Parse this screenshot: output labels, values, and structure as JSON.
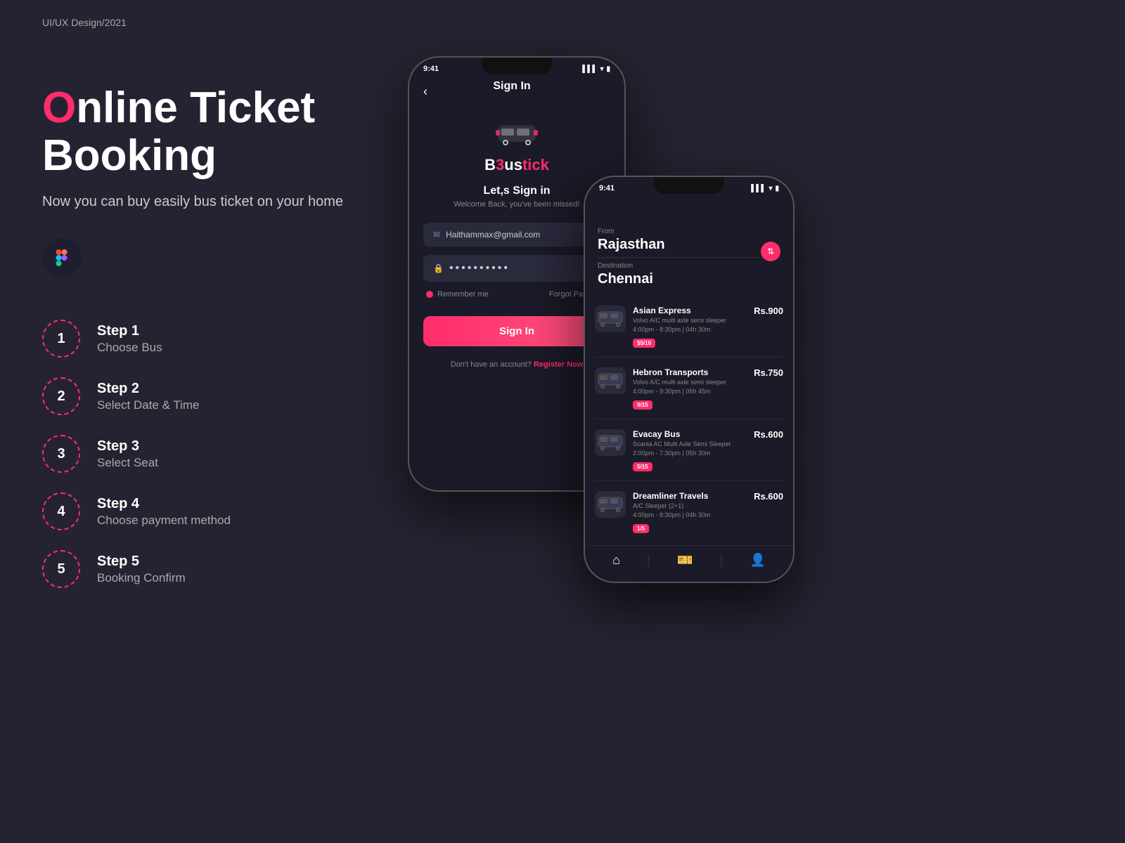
{
  "header": {
    "label": "UI/UX Design/2021"
  },
  "hero": {
    "title_prefix": "",
    "title_accent": "O",
    "title_rest": "nline Ticket Booking",
    "subtitle": "Now you can buy easily bus ticket on your home"
  },
  "steps": [
    {
      "number": "1",
      "title": "Step 1",
      "desc": "Choose Bus"
    },
    {
      "number": "2",
      "title": "Step 2",
      "desc": "Select Date & Time"
    },
    {
      "number": "3",
      "title": "Step 3",
      "desc": "Select Seat"
    },
    {
      "number": "4",
      "title": "Step 4",
      "desc": "Choose payment method"
    },
    {
      "number": "5",
      "title": "Step 5",
      "desc": "Booking Confirm"
    }
  ],
  "phone1": {
    "time": "9:41",
    "screen_title": "Sign In",
    "logo_prefix": "B",
    "logo_name": "ustick",
    "welcome_title": "Let,s Sign in",
    "welcome_sub": "Welcome Back, you've been missed!",
    "email_value": "Haithammax@gmail.com",
    "password_dots": "••••••••••",
    "remember_label": "Remember me",
    "forgot_label": "Forgot Password",
    "signin_btn": "Sign In",
    "register_text": "Don't have an account?",
    "register_link": "Register Now"
  },
  "phone2": {
    "time": "9:41",
    "from_label": "From",
    "from_city": "Rajasthan",
    "dest_label": "Destination",
    "dest_city": "Chennai",
    "buses": [
      {
        "name": "Asian Express",
        "type": "Volvo A/C multi axle semi sleeper",
        "time": "4:00pm - 8:30pm | 04h 30m",
        "seats": "$5/10",
        "price": "Rs.900"
      },
      {
        "name": "Hebron Transports",
        "type": "Volvo A/C multi axle semi sleeper",
        "time": "4:00pm - 9:30pm | 05h 45m",
        "seats": "9/15",
        "price": "Rs.750"
      },
      {
        "name": "Evacay Bus",
        "type": "Scania AC Multi Axle Semi Sleeper",
        "time": "2:00pm - 7:30pm | 05h 30m",
        "seats": "5/15",
        "price": "Rs.600"
      },
      {
        "name": "Dreamliner Travels",
        "type": "A/C Sleeper (2+1)",
        "time": "4:00pm - 8:30pm | 04h 30m",
        "seats": "1/5",
        "price": "Rs.600"
      }
    ]
  },
  "colors": {
    "accent": "#ff2d6b",
    "bg": "#252331",
    "card_bg": "#1a1a28"
  }
}
